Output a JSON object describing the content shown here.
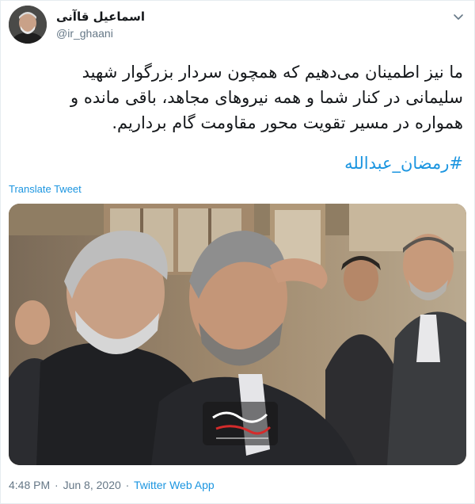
{
  "tweet": {
    "author_name": "اسماعیل قاآنی",
    "author_handle": "@ir_ghaani",
    "text_lines": [
      "ما نیز اطمینان می‌دهیم که همچون سردار بزرگوار شهید",
      "سلیمانی در کنار شما و همه نیروهای مجاهد، باقی مانده و",
      "همواره در مسیر تقویت محور مقاومت گام برداریم."
    ],
    "hashtag": "#رمضان_عبدالله",
    "translate_label": "Translate Tweet",
    "time": "4:48 PM",
    "separator": "·",
    "date": "Jun 8, 2020",
    "source": "Twitter Web App"
  },
  "icons": {
    "menu": "chevron-down-icon",
    "avatar": "profile-avatar"
  },
  "colors": {
    "link": "#1b95e0",
    "secondary_text": "#657786",
    "primary_text": "#14171a",
    "border": "#e6ecf0"
  }
}
